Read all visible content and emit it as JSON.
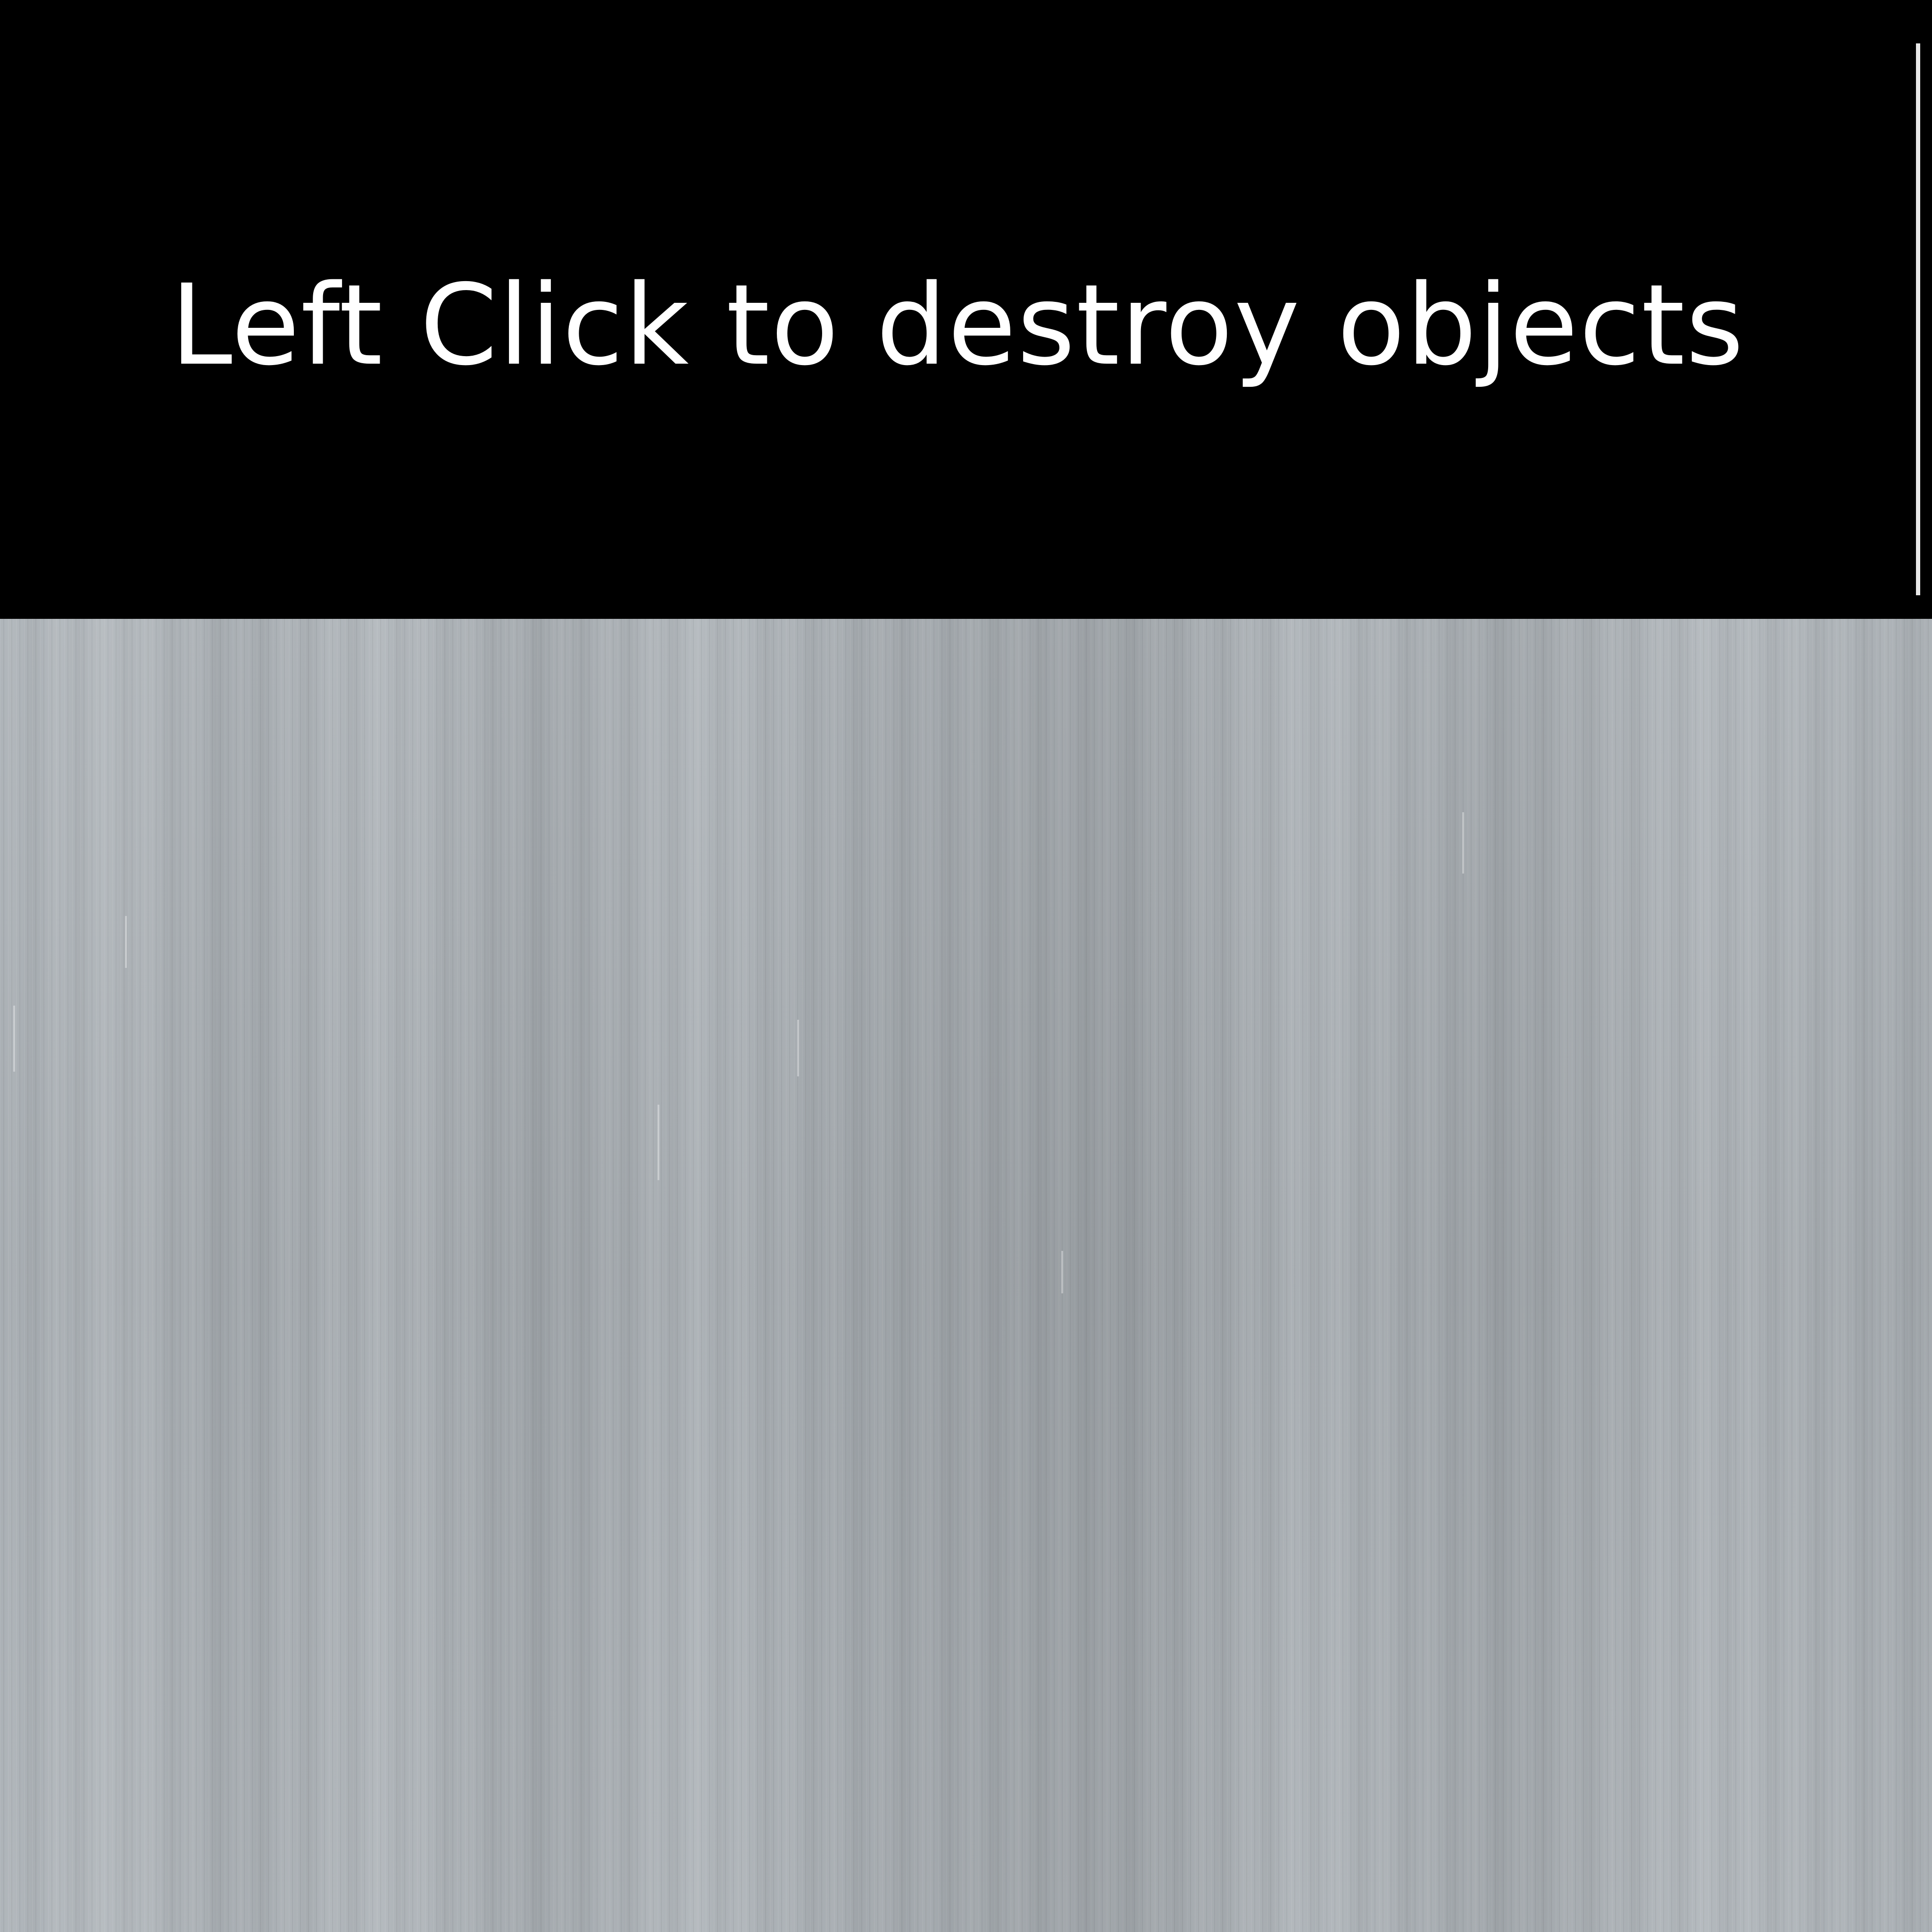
{
  "banner": {
    "instruction": "Left Click to destroy objects",
    "background_color": "#000000",
    "text_color": "#ffffff"
  },
  "play_area": {
    "texture": "brushed-metal",
    "base_color": "#abb1b6"
  }
}
